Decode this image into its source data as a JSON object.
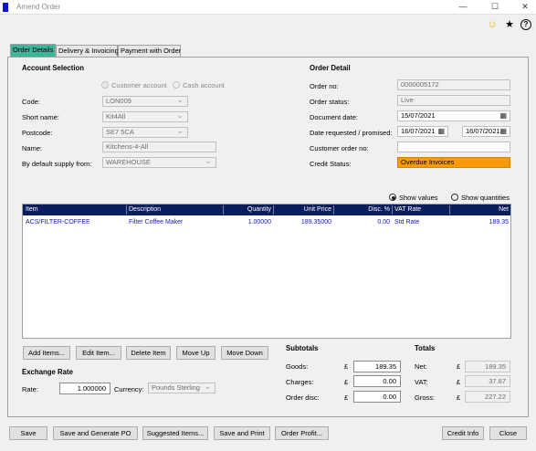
{
  "window": {
    "title": "Amend Order",
    "minimize": "—",
    "maximize": "☐",
    "close": "✕"
  },
  "toolbar_icons": [
    {
      "name": "smiley-icon",
      "glyph": "☺",
      "color": "#e8b800"
    },
    {
      "name": "star-icon",
      "glyph": "★",
      "color": "#111"
    },
    {
      "name": "help-icon",
      "glyph": "?",
      "color": "#111"
    }
  ],
  "tabs": {
    "order_details": "Order Details",
    "delivery": "Delivery & Invoicing",
    "payment": "Payment with Order"
  },
  "account": {
    "heading": "Account Selection",
    "radio_customer": "Customer account",
    "radio_cash": "Cash account",
    "code_label": "Code:",
    "code_value": "LON009",
    "short_label": "Short name:",
    "short_value": "Kit4All",
    "postcode_label": "Postcode:",
    "postcode_value": "SE7 5CA",
    "name_label": "Name:",
    "name_value": "Kitchens-4-All",
    "supply_label": "By default supply from:",
    "supply_value": "WAREHOUSE"
  },
  "order": {
    "heading": "Order Detail",
    "no_label": "Order no:",
    "no_value": "0000005172",
    "status_label": "Order status:",
    "status_value": "Live",
    "docdate_label": "Document date:",
    "docdate_value": "15/07/2021",
    "date_req_label": "Date requested / promised:",
    "date_req_value": "16/07/2021",
    "date_prom_value": "16/07/2021",
    "custno_label": "Customer order no:",
    "custno_value": "",
    "credit_label": "Credit Status:",
    "credit_value": "Overdue Invoices"
  },
  "view": {
    "show_values": "Show values",
    "show_quantities": "Show quantities"
  },
  "grid": {
    "headers": {
      "item": "Item",
      "description": "Description",
      "quantity": "Quantity",
      "unit_price": "Unit Price",
      "disc": "Disc. %",
      "vat_rate": "VAT Rate",
      "net": "Net"
    },
    "rows": [
      {
        "item": "ACS/FILTER-COFFEE",
        "description": "Filter Coffee Maker",
        "quantity": "1.00000",
        "unit_price": "189.35000",
        "disc": "0.00",
        "vat_rate": "Std Rate",
        "net": "189.35"
      }
    ]
  },
  "item_buttons": {
    "add": "Add Items...",
    "edit": "Edit Item...",
    "delete": "Delete Item",
    "move_up": "Move Up",
    "move_down": "Move Down"
  },
  "exchange": {
    "heading": "Exchange Rate",
    "rate_label": "Rate:",
    "rate_value": "1.000000",
    "currency_label": "Currency:",
    "currency_value": "Pounds Sterling"
  },
  "subtotals": {
    "heading": "Subtotals",
    "goods_label": "Goods:",
    "goods": "189.35",
    "charges_label": "Charges:",
    "charges": "0.00",
    "disc_label": "Order disc:",
    "disc": "0.00",
    "currency_symbol": "£"
  },
  "totals": {
    "heading": "Totals",
    "net_label": "Net:",
    "net": "189.35",
    "vat_label": "VAT:",
    "vat": "37.87",
    "gross_label": "Gross:",
    "gross": "227.22"
  },
  "footer_buttons": {
    "save": "Save",
    "save_po": "Save and Generate PO",
    "suggested": "Suggested Items...",
    "save_print": "Save and Print",
    "profit": "Order Profit...",
    "credit": "Credit Info",
    "close": "Close"
  }
}
